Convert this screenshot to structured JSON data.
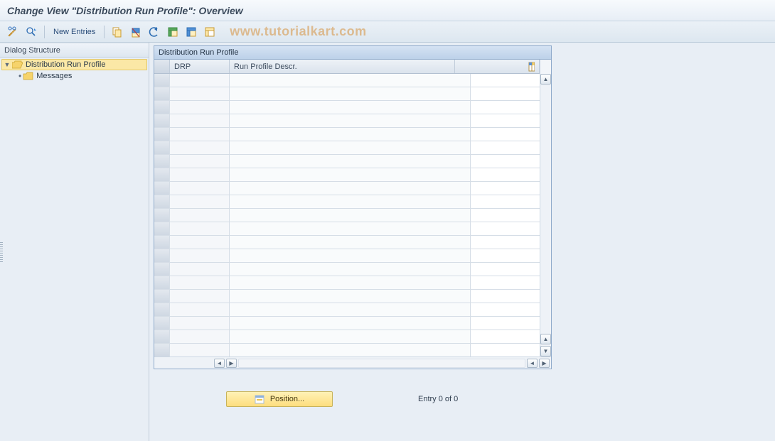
{
  "title": "Change View \"Distribution Run Profile\": Overview",
  "watermark": "www.tutorialkart.com",
  "toolbar": {
    "new_entries": "New Entries"
  },
  "sidebar": {
    "header": "Dialog Structure",
    "items": [
      {
        "label": "Distribution Run Profile",
        "selected": true,
        "open": true
      },
      {
        "label": "Messages",
        "selected": false,
        "open": false
      }
    ]
  },
  "panel": {
    "title": "Distribution Run Profile",
    "columns": {
      "drp": "DRP",
      "descr": "Run Profile Descr."
    },
    "rows": []
  },
  "footer": {
    "position_label": "Position...",
    "entry_info": "Entry 0 of 0"
  },
  "colors": {
    "accent_yellow": "#fdde7e",
    "header_blue": "#c9dbef"
  }
}
